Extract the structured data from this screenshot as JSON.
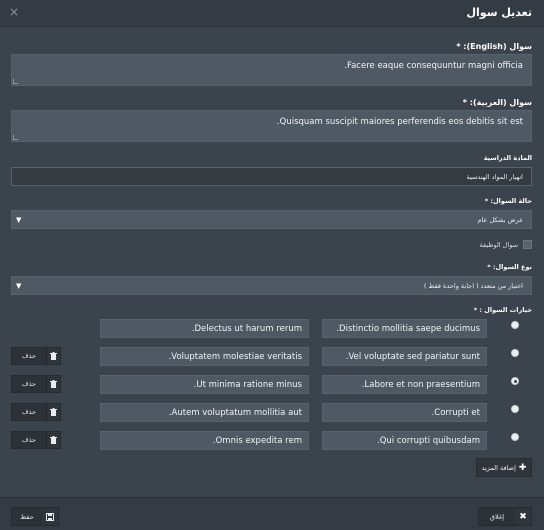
{
  "header": {
    "title": "تعديل سوال",
    "close_glyph": "×"
  },
  "form": {
    "question_en": {
      "label": "سوال (English): *",
      "value": "Facere eaque consequuntur magni officia."
    },
    "question_ar": {
      "label": "سوال (العربية): *",
      "value": "Quisquam suscipit maiores perferendis eos debitis sit est."
    },
    "subject": {
      "label": "المادة الدراسية",
      "value": "انهيار المواد الهندسية"
    },
    "status": {
      "label": "حالة السوال: *",
      "value": "عرض بشكل عام"
    },
    "job_question": {
      "label": "سوال الوظيفة",
      "checked": false
    },
    "type": {
      "label": "نوع السوال: *",
      "value": "اختيار من متعدد ( اجابة واحدة فقط )"
    },
    "options_label": "خيارات السوال : *",
    "options": [
      {
        "en": "Distinctio mollitia saepe ducimus.",
        "ar": "Delectus ut harum rerum.",
        "checked": false,
        "deletable": false
      },
      {
        "en": "Vel voluptate sed pariatur sunt.",
        "ar": "Voluptatem molestiae veritatis.",
        "checked": false,
        "deletable": true
      },
      {
        "en": "Labore et non praesentium.",
        "ar": "Ut minima ratione minus.",
        "checked": true,
        "deletable": true
      },
      {
        "en": "Corrupti et.",
        "ar": "Autem voluptatum mollitia aut.",
        "checked": false,
        "deletable": true
      },
      {
        "en": "Qui corrupti quibusdam.",
        "ar": "Omnis expedita rem.",
        "checked": false,
        "deletable": true
      }
    ],
    "delete_label": "حذف",
    "add_more_label": "إضافة المزيد"
  },
  "footer": {
    "close_label": "إغلاق",
    "save_label": "حفظ"
  },
  "colors": {
    "background": "#3b434c",
    "field": "#4f5963",
    "button": "#2c3238"
  }
}
